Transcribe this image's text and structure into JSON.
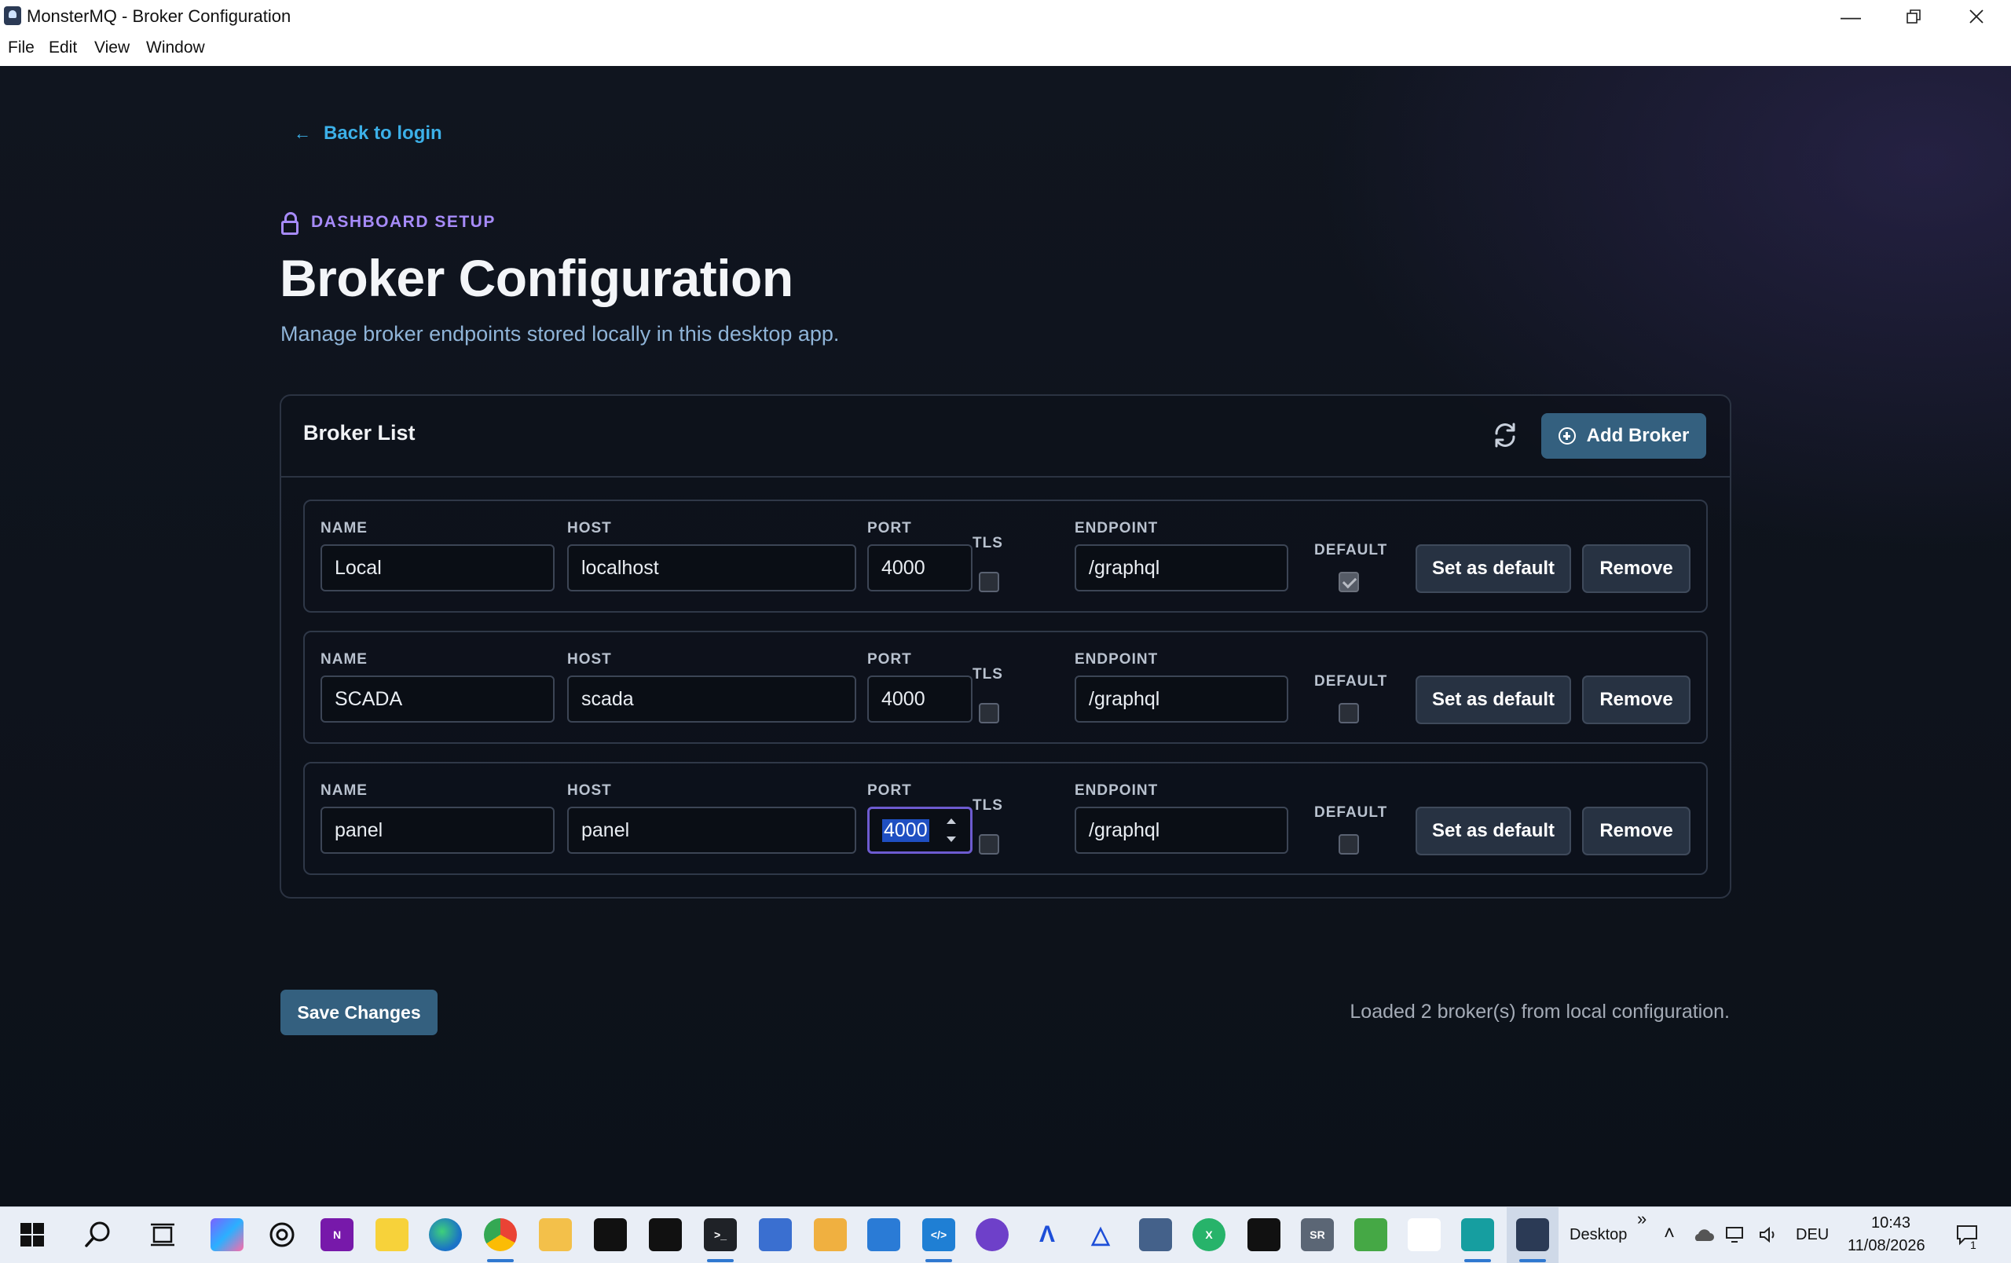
{
  "window": {
    "title": "MonsterMQ - Broker Configuration",
    "menu": [
      "File",
      "Edit",
      "View",
      "Window"
    ]
  },
  "nav": {
    "back_label": "Back to login"
  },
  "header": {
    "eyebrow": "DASHBOARD SETUP",
    "title": "Broker Configuration",
    "subtitle": "Manage broker endpoints stored locally in this desktop app."
  },
  "card": {
    "title": "Broker List",
    "add_label": "Add Broker",
    "columns": {
      "name": "NAME",
      "host": "HOST",
      "port": "PORT",
      "tls": "TLS",
      "endpoint": "ENDPOINT",
      "default": "DEFAULT"
    },
    "set_default_label": "Set as default",
    "remove_label": "Remove",
    "brokers": [
      {
        "name": "Local",
        "host": "localhost",
        "port": "4000",
        "tls": false,
        "endpoint": "/graphql",
        "is_default": true
      },
      {
        "name": "SCADA",
        "host": "scada",
        "port": "4000",
        "tls": false,
        "endpoint": "/graphql",
        "is_default": false
      },
      {
        "name": "panel",
        "host": "panel",
        "port": "4000",
        "tls": false,
        "endpoint": "/graphql",
        "is_default": false
      }
    ]
  },
  "footer": {
    "save_label": "Save Changes",
    "status": "Loaded 2 broker(s) from local configuration."
  },
  "taskbar": {
    "desktop_label": "Desktop",
    "chevron": "»",
    "language": "DEU",
    "time": "10:43",
    "date": "11/08/2026",
    "notification_count": "1",
    "icons": [
      "start-icon",
      "search-icon",
      "task-view-icon",
      "copilot-m365-icon",
      "chatgpt-icon",
      "onenote-icon",
      "sticky-notes-icon",
      "edge-icon",
      "chrome-icon",
      "file-explorer-icon",
      "terminal-icon",
      "terminal-icon-2",
      "powershell-icon",
      "remote-desktop-icon",
      "mail-icon",
      "store-icon",
      "vscode-icon",
      "github-desktop-icon",
      "app-a-icon",
      "app-triangle-icon",
      "app-network-icon",
      "xmind-icon",
      "paw-icon",
      "simarn-icon",
      "expert-icon",
      "niryo-icon",
      "siemens-icon",
      "monstermq-icon"
    ]
  },
  "colors": {
    "accent_link": "#3cb0e8",
    "eyebrow": "#a78bfa",
    "primary_button": "#34607f",
    "focus_ring": "#6d5bd0"
  }
}
